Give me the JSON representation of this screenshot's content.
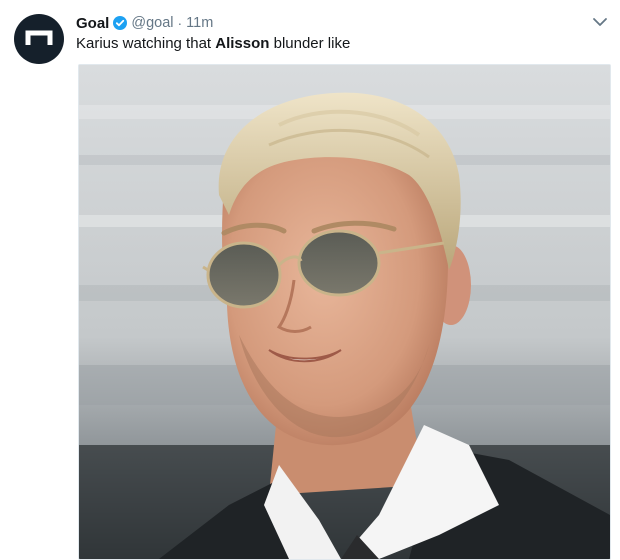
{
  "tweet": {
    "author_name": "Goal",
    "handle": "@goal",
    "separator": "·",
    "time": "11m",
    "text_before": "Karius watching that ",
    "text_bold": "Alisson",
    "text_after": " blunder like",
    "verified": true
  },
  "icons": {
    "avatar": "goal-logo-icon",
    "verified": "verified-badge-icon",
    "menu": "chevron-down-icon"
  },
  "colors": {
    "name": "#14171a",
    "secondary": "#657786",
    "verified": "#1da1f2",
    "avatar_bg": "#15202b"
  },
  "media": {
    "alt": "Photo of a blond man with slicked-back hair wearing tinted round sunglasses, white shirt and dark suit in a stadium"
  }
}
